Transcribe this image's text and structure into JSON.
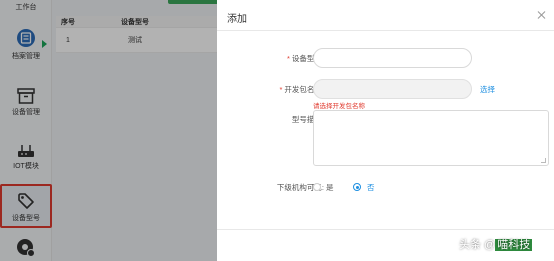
{
  "sidebar": {
    "items": [
      {
        "label": "工作台",
        "icon": "workbench-icon"
      },
      {
        "label": "档案管理",
        "icon": "archive-icon"
      },
      {
        "label": "设备管理",
        "icon": "device-box-icon"
      },
      {
        "label": "IOT模块",
        "icon": "router-icon"
      },
      {
        "label": "设备型号",
        "icon": "tag-icon"
      },
      {
        "label": "",
        "icon": "settings-icon"
      }
    ]
  },
  "table": {
    "headers": [
      "序号",
      "设备型号"
    ],
    "rows": [
      [
        "1",
        "测试"
      ]
    ]
  },
  "modal": {
    "title": "添加",
    "fields": {
      "model": {
        "label": "设备型号:",
        "value": "",
        "placeholder": ""
      },
      "package": {
        "label": "开发包名称:",
        "value": "",
        "select_label": "选择",
        "error": "请选择开发包名称"
      },
      "description": {
        "label": "型号描述:"
      },
      "visible": {
        "label": "下级机构可见:",
        "options": [
          "是",
          "否"
        ],
        "selected": "否"
      }
    }
  },
  "watermark": {
    "prefix": "头条 @",
    "highlight": "喵科技"
  },
  "colors": {
    "accent": "#1e8fe1",
    "error": "#e03a2e",
    "brand_green": "#3da85c"
  }
}
